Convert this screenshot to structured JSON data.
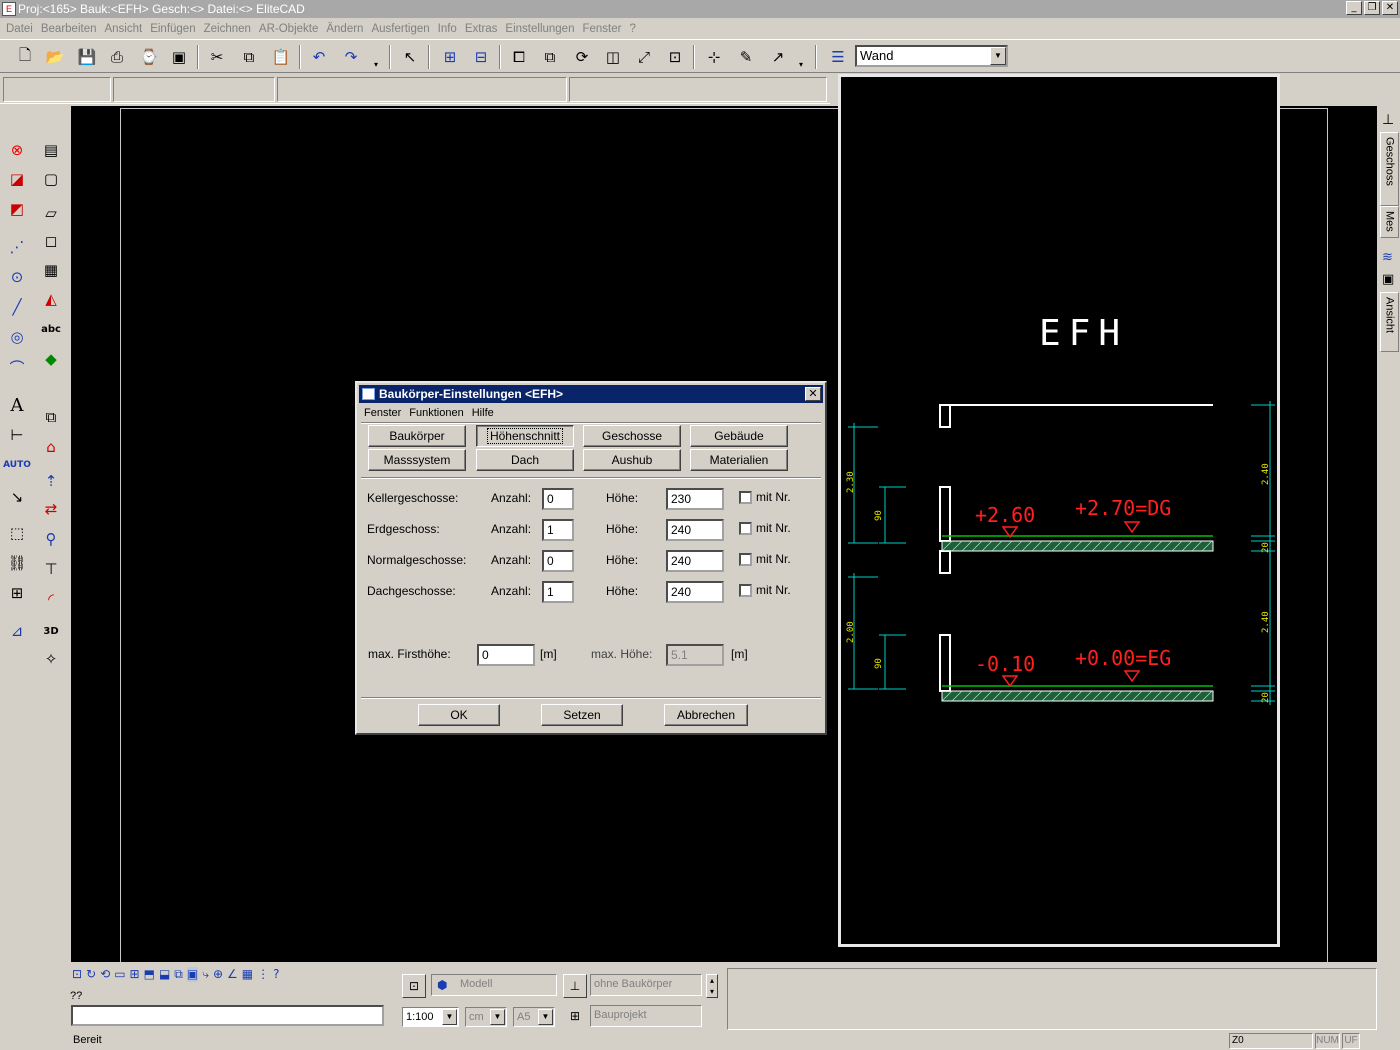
{
  "window": {
    "title": "Proj:<165> Bauk:<EFH> Gesch:<> Datei:<> EliteCAD"
  },
  "menu": [
    "Datei",
    "Bearbeiten",
    "Ansicht",
    "Einfügen",
    "Zeichnen",
    "AR-Objekte",
    "Ändern",
    "Ausfertigen",
    "Info",
    "Extras",
    "Einstellungen",
    "Fenster",
    "?"
  ],
  "toolbar": {
    "layer_combo": "Wand"
  },
  "right_tabs": [
    "Geschoss",
    "Mes",
    "Ansicht"
  ],
  "drawing": {
    "title": "EFH",
    "dg_level": "+2.60",
    "dg_label": "+2.70=DG",
    "eg_level": "-0.10",
    "eg_label": "+0.00=EG",
    "left_dims": [
      "2.30",
      "90",
      "2.00",
      "90"
    ],
    "right_dims": [
      "2.40",
      "20",
      "2.40",
      "20"
    ],
    "colors": {
      "level_text": "#ff2020",
      "dim": "#00d0c0",
      "dim_text": "#e8e800",
      "lines": "#ffffff",
      "slab": "#00c000"
    }
  },
  "dialog": {
    "title": "Baukörper-Einstellungen <EFH>",
    "menu": [
      "Fenster",
      "Funktionen",
      "Hilfe"
    ],
    "tabs_row1": [
      "Baukörper",
      "Höhenschnitt",
      "Geschosse",
      "Gebäude"
    ],
    "tabs_row2": [
      "Masssystem",
      "Dach",
      "Aushub",
      "Materialien"
    ],
    "active_tab": "Höhenschnitt",
    "rows": [
      {
        "label": "Kellergeschosse:",
        "count_label": "Anzahl:",
        "count": "0",
        "height_label": "Höhe:",
        "height": "230",
        "chk_label": "mit Nr."
      },
      {
        "label": "Erdgeschoss:",
        "count_label": "Anzahl:",
        "count": "1",
        "height_label": "Höhe:",
        "height": "240",
        "chk_label": "mit Nr."
      },
      {
        "label": "Normalgeschosse:",
        "count_label": "Anzahl:",
        "count": "0",
        "height_label": "Höhe:",
        "height": "240",
        "chk_label": "mit Nr."
      },
      {
        "label": "Dachgeschosse:",
        "count_label": "Anzahl:",
        "count": "1",
        "height_label": "Höhe:",
        "height": "240",
        "chk_label": "mit Nr."
      }
    ],
    "max_first_label": "max. Firsthöhe:",
    "max_first_value": "0",
    "unit": "[m]",
    "max_height_label": "max. Höhe:",
    "max_height_value": "5.1",
    "ok": "OK",
    "set": "Setzen",
    "cancel": "Abbrechen"
  },
  "bottom": {
    "prompt": "??",
    "model_combo": "Modell",
    "body_combo": "ohne Baukörper",
    "project_combo": "Bauprojekt",
    "scale": "1:100",
    "unit": "cm",
    "paper": "A5",
    "status": "Bereit",
    "zoom": "Z0",
    "num": "NUM",
    "uf": "UF"
  }
}
